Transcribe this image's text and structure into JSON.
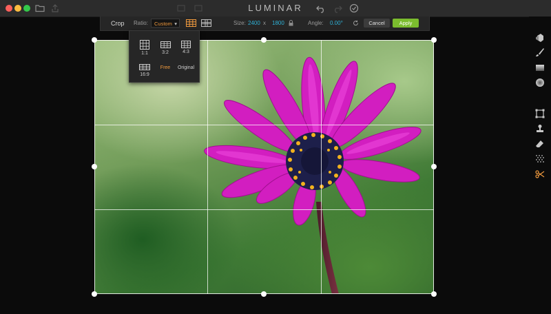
{
  "app": {
    "title": "LUMINAR"
  },
  "toolbar": {
    "crop_label": "Crop",
    "ratio_label": "Ratio:",
    "ratio_value": "Custom",
    "size_label": "Size:",
    "width": "2400",
    "size_separator": "x",
    "height": "1800",
    "angle_label": "Angle:",
    "angle_value": "0.00°",
    "cancel_label": "Cancel",
    "apply_label": "Apply"
  },
  "ratio_menu": {
    "options": [
      {
        "label": "1:1"
      },
      {
        "label": "3:2"
      },
      {
        "label": "4:3"
      },
      {
        "label": "16:9"
      },
      {
        "label": "Free",
        "selected": true
      },
      {
        "label": "Original"
      }
    ]
  },
  "colors": {
    "accent_orange": "#f09a3e",
    "value_blue": "#2fb1d6",
    "apply_green": "#7bbd2e",
    "active_tool": "#f09a3e"
  },
  "tools": [
    {
      "icon": "layers-icon"
    },
    {
      "icon": "brush-icon"
    },
    {
      "icon": "gradient-icon"
    },
    {
      "icon": "radial-icon"
    },
    {
      "icon": "transform-icon"
    },
    {
      "icon": "clone-stamp-icon"
    },
    {
      "icon": "erase-icon"
    },
    {
      "icon": "noise-icon"
    },
    {
      "icon": "crop-scissors-icon",
      "active": true
    }
  ]
}
